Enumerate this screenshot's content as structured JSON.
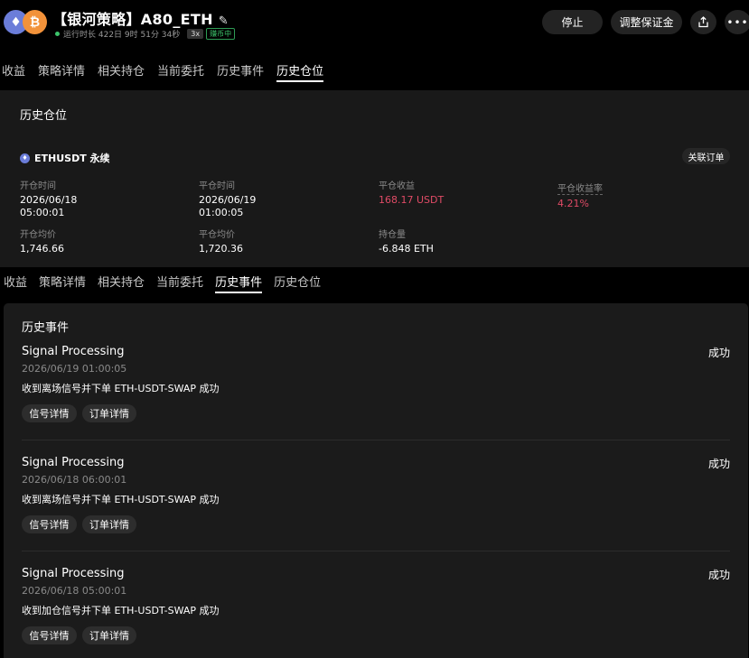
{
  "header": {
    "title": "【银河策略】A80_ETH",
    "runtime": "运行时长 422日 9时 51分 34秒",
    "leverage_badge": "3x",
    "mode_badge": "赚币中",
    "stop_label": "停止",
    "adjust_margin_label": "调整保证金"
  },
  "tabs_top": [
    "收益",
    "策略详情",
    "相关持仓",
    "当前委托",
    "历史事件",
    "历史仓位"
  ],
  "tabs_top_active": "历史仓位",
  "tabs_mid": [
    "收益",
    "策略详情",
    "相关持仓",
    "当前委托",
    "历史事件",
    "历史仓位"
  ],
  "tabs_mid_active": "历史事件",
  "history_position": {
    "title": "历史仓位",
    "pair": "ETHUSDT 永续",
    "linked_orders_label": "关联订单",
    "open_time_label": "开仓时间",
    "open_time_date": "2026/06/18",
    "open_time_clock": "05:00:01",
    "close_time_label": "平仓时间",
    "close_time_date": "2026/06/19",
    "close_time_clock": "01:00:05",
    "close_pnl_label": "平仓收益",
    "close_pnl_value": "168.17 USDT",
    "close_pnl_rate_label": "平仓收益率",
    "close_pnl_rate_value": "4.21%",
    "open_avg_label": "开仓均价",
    "open_avg_value": "1,746.66",
    "close_avg_label": "平仓均价",
    "close_avg_value": "1,720.36",
    "position_size_label": "持仓量",
    "position_size_value": "-6.848 ETH"
  },
  "history_events": {
    "title": "历史事件",
    "signal_detail_label": "信号详情",
    "order_detail_label": "订单详情",
    "items": [
      {
        "name": "Signal Processing",
        "status": "成功",
        "time": "2026/06/19 01:00:05",
        "message": "收到离场信号并下单 ETH-USDT-SWAP 成功"
      },
      {
        "name": "Signal Processing",
        "status": "成功",
        "time": "2026/06/18 06:00:01",
        "message": "收到离场信号并下单 ETH-USDT-SWAP 成功"
      },
      {
        "name": "Signal Processing",
        "status": "成功",
        "time": "2026/06/18 05:00:01",
        "message": "收到加仓信号并下单 ETH-USDT-SWAP 成功"
      }
    ]
  },
  "colors": {
    "profit_red": "#e04b66",
    "running_green": "#3cc46b",
    "panel_bg": "#191919"
  },
  "icons": [
    "eth-icon",
    "btc-icon",
    "edit-icon",
    "share-icon",
    "more-icon"
  ]
}
